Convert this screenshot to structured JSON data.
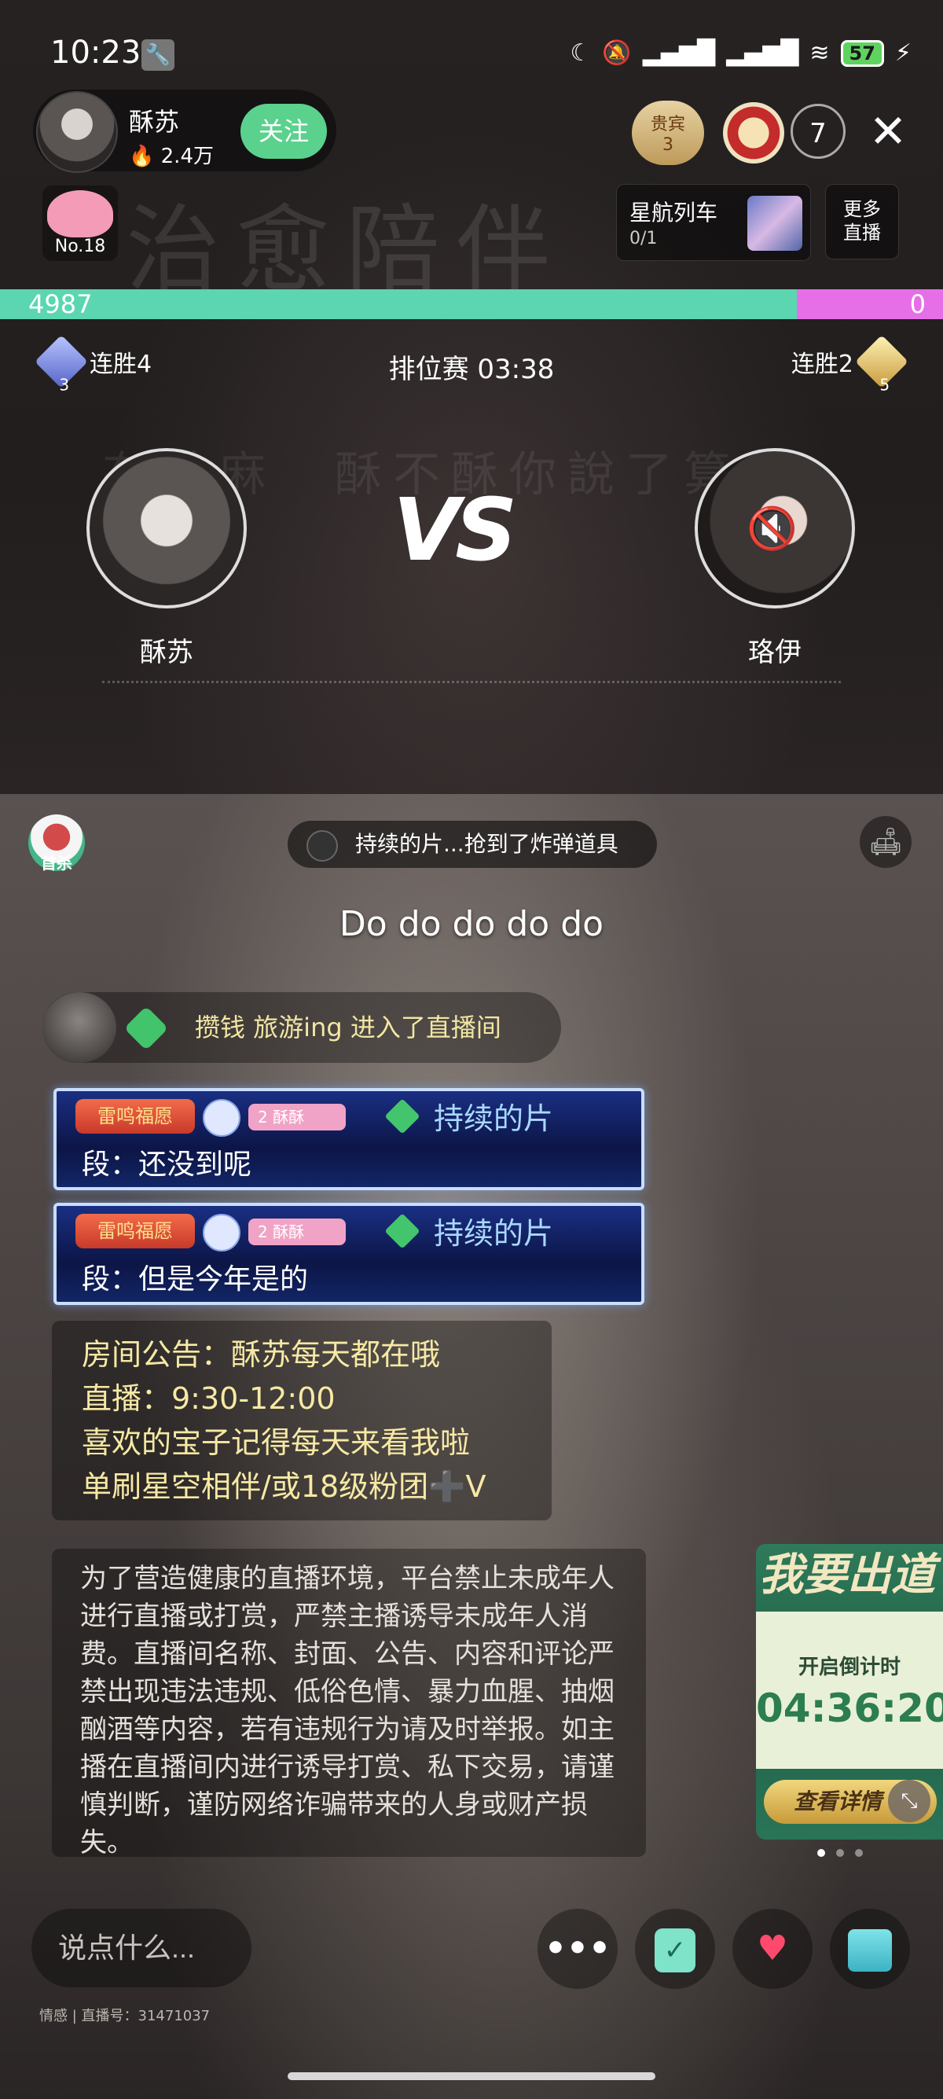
{
  "status_bar": {
    "time": "10:23",
    "battery": "57"
  },
  "header": {
    "anchor_name": "酥苏",
    "anchor_fans": "2.4万",
    "follow_label": "关注",
    "vip_label": "贵宾",
    "vip_count": "3",
    "viewer_count": "7",
    "rank_label": "No.18",
    "train_title": "星航列车",
    "train_count": "0/1",
    "more_live_line1": "更多",
    "more_live_line2": "直播"
  },
  "pk": {
    "left_score": "4987",
    "right_score": "0",
    "left_progress": 0.845,
    "left_streak": "连胜4",
    "left_streak_level": "3",
    "right_streak": "连胜2",
    "right_streak_level": "5",
    "ranked_label": "排位赛 03:38",
    "vs_label": "VS",
    "left_name": "酥苏",
    "right_name": "珞伊"
  },
  "chat": {
    "first_kill_label": "首杀",
    "bomb_notice": "持续的片...抢到了炸弹道具",
    "song_title": "Do do do do do",
    "enter_message": "攒钱 旅游ing 进入了直播间",
    "messages": [
      {
        "badge": "雷鸣福愿",
        "fan_badge": "酥酥",
        "fan_level": "2",
        "user": "持续的片",
        "text": "段：还没到呢"
      },
      {
        "badge": "雷鸣福愿",
        "fan_badge": "酥酥",
        "fan_level": "2",
        "user": "持续的片",
        "text": "段：但是今年是的"
      }
    ],
    "notice_lines": [
      "房间公告：酥苏每天都在哦",
      "直播：9:30-12:00",
      "喜欢的宝子记得每天来看我啦",
      "单刷星空相伴/或18级粉团➕V"
    ],
    "rules_text": "为了营造健康的直播环境，平台禁止未成年人进行直播或打赏，严禁主播诱导未成年人消费。直播间名称、封面、公告、内容和评论严禁出现违法违规、低俗色情、暴力血腥、抽烟酗酒等内容，若有违规行为请及时举报。如主播在直播间内进行诱导打赏、私下交易，请谨慎判断，谨防网络诈骗带来的人身或财产损失。"
  },
  "event_card": {
    "title": "我要出道",
    "countdown_label": "开启倒计时",
    "countdown": "04:36:20",
    "detail_label": "查看详情"
  },
  "bottom": {
    "input_placeholder": "说点什么...",
    "live_id": "情感 | 直播号：31471037"
  }
}
